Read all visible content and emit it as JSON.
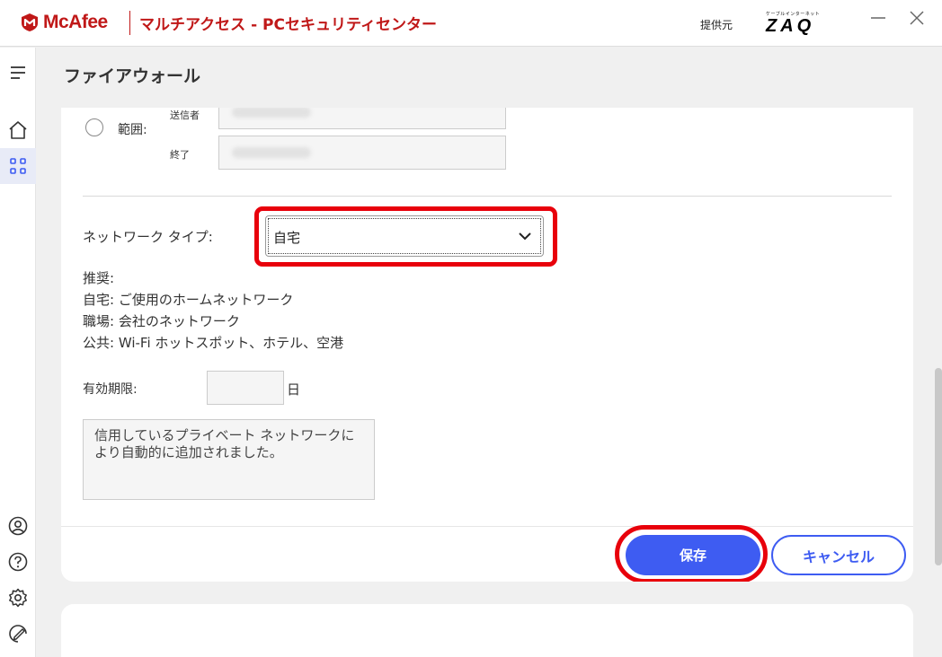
{
  "app": {
    "brand": "McAfee",
    "title": "マルチアクセス - PCセキュリティセンター",
    "provider_label": "提供元",
    "provider_sub": "ケーブルインターネット",
    "provider_logo": "ZAQ",
    "brand_color": "#c01818"
  },
  "window": {
    "minimize_icon": "minimize-icon",
    "close_icon": "close-icon"
  },
  "rail": {
    "items": [
      "menu-icon",
      "home-icon",
      "apps-grid-icon",
      "account-icon",
      "help-icon",
      "settings-icon",
      "feedback-icon"
    ],
    "active": "apps-grid-icon"
  },
  "page": {
    "title": "ファイアウォール"
  },
  "range": {
    "label": "範囲:",
    "from_label": "送信者",
    "to_label": "終了"
  },
  "network": {
    "label": "ネットワーク タイプ:",
    "selected": "自宅"
  },
  "recommendation": {
    "heading": "推奨:",
    "lines": [
      "自宅: ご使用のホームネットワーク",
      "職場: 会社のネットワーク",
      "公共: Wi-Fi ホットスポット、ホテル、空港"
    ]
  },
  "expiry": {
    "label": "有効期限:",
    "value": "",
    "unit": "日"
  },
  "description": {
    "text": "信用しているプライベート ネットワークにより自動的に追加されました。"
  },
  "actions": {
    "save": "保存",
    "cancel": "キャンセル",
    "accent": "#3e5cf2",
    "highlight": "#e8000b"
  }
}
